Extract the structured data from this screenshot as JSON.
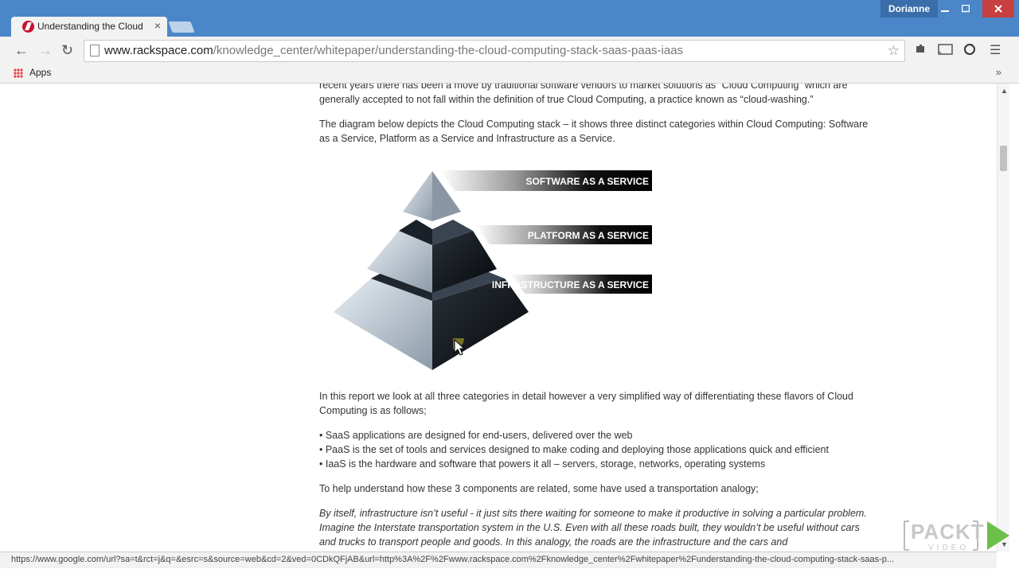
{
  "window": {
    "user": "Dorianne",
    "minimize_icon": "minimize-icon",
    "maximize_icon": "maximize-icon",
    "close_icon": "close-icon"
  },
  "tab": {
    "title": "Understanding the Cloud",
    "close": "×"
  },
  "toolbar": {
    "back": "←",
    "forward": "→",
    "reload": "↻",
    "url_host": "www.rackspace.com",
    "url_path": "/knowledge_center/whitepaper/understanding-the-cloud-computing-stack-saas-paas-iaas",
    "star": "☆",
    "menu": "☰"
  },
  "bookmarks": {
    "apps_label": "Apps",
    "more": "»"
  },
  "article": {
    "p0": "recent years there has been a move by traditional software vendors to market solutions as “Cloud Computing” which are generally accepted to not fall within the definition of true Cloud Computing, a practice known as “cloud-washing.”",
    "p1": "The diagram below depicts the Cloud Computing stack – it shows three distinct categories within Cloud Computing: Software as a Service, Platform as a Service and Infrastructure as a Service.",
    "diagram_labels": [
      "SOFTWARE AS A SERVICE",
      "PLATFORM AS A SERVICE",
      "INFRASTRUCTURE AS A SERVICE"
    ],
    "p2": "In this report we look at all three categories in detail however a very simplified way of differentiating these flavors of Cloud Computing is as follows;",
    "bullets": [
      "• SaaS applications are designed for end-users, delivered over the web",
      "• PaaS is the set of tools and services designed to make coding and deploying those applications quick and efficient",
      "• IaaS is the hardware and software that powers it all – servers, storage, networks, operating systems"
    ],
    "p3": "To help understand how these 3 components are related, some have used a transportation analogy;",
    "p4": "By itself, infrastructure isn’t useful - it just sits there waiting for someone to make it productive in solving a particular problem. Imagine the Interstate transportation system in the U.S. Even with all these roads built, they wouldn’t be useful without cars and trucks to transport people and goods. In this analogy, the roads are the infrastructure and the cars and"
  },
  "status": {
    "url": "https://www.google.com/url?sa=t&rct=j&q=&esrc=s&source=web&cd=2&ved=0CDkQFjAB&url=http%3A%2F%2Fwww.rackspace.com%2Fknowledge_center%2Fwhitepaper%2Funderstanding-the-cloud-computing-stack-saas-p..."
  },
  "watermark": {
    "brand": "PACKT",
    "sub": "VIDEO"
  }
}
